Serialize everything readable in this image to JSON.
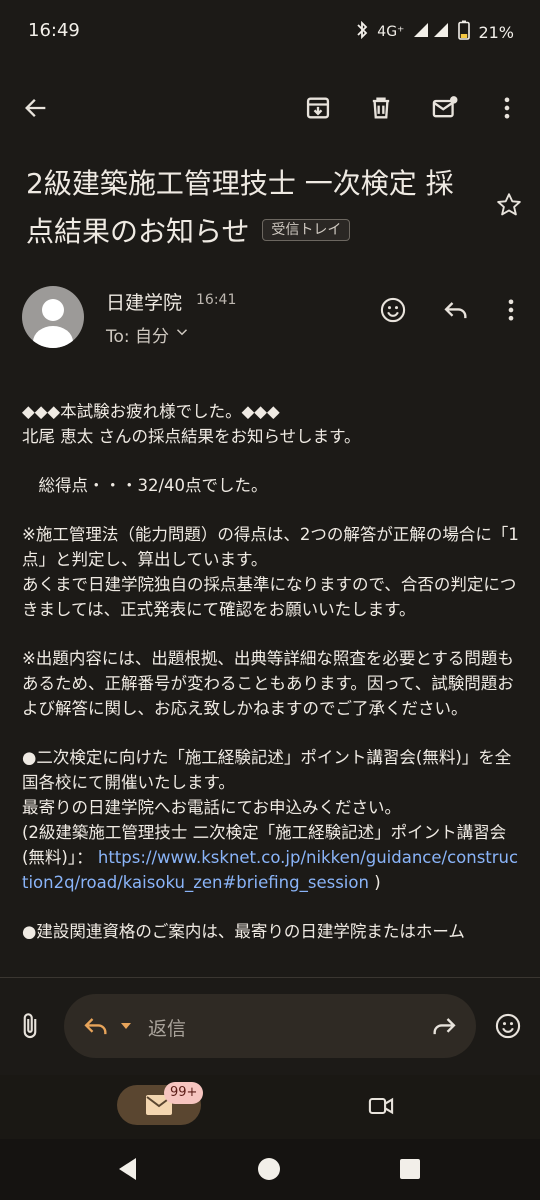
{
  "status_bar": {
    "time": "16:49",
    "network": "4G⁺",
    "battery": "21%"
  },
  "toolbar": {
    "icons": [
      "back-arrow-icon",
      "archive-icon",
      "delete-icon",
      "mark-unread-icon",
      "more-vert-icon"
    ]
  },
  "email": {
    "subject": "2級建築施工管理技士 一次検定 採点結果のお知らせ",
    "label_chip": "受信トレイ",
    "sender": "日建学院",
    "time": "16:41",
    "to": "To: 自分",
    "body": {
      "line1": "◆◆◆本試験お疲れ様でした。◆◆◆",
      "line2": "北尾 恵太 さんの採点結果をお知らせします。",
      "score": "　総得点・・・32/40点でした。",
      "note1": "※施工管理法（能力問題）の得点は、2つの解答が正解の場合に「1点」と判定し、算出しています。",
      "note2": "あくまで日建学院独自の採点基準になりますので、合否の判定につきましては、正式発表にて確認をお願いいたします。",
      "note3": "※出題内容には、出題根拠、出典等詳細な照査を必要とする問題もあるため、正解番号が変わることもあります。因って、試験問題および解答に関し、お応え致しかねますのでご了承ください。",
      "seminar1": "●二次検定に向けた「施工経験記述」ポイント講習会(無料)」を全国各校にて開催いたします。",
      "seminar2": "最寄りの日建学院へお電話にてお申込みください。",
      "seminar3": "(2級建築施工管理技士 二次検定「施工経験記述」ポイント講習会(無料)」：",
      "link": "https://www.ksknet.co.jp/nikken/guidance/construction2q/road/kaisoku_zen#briefing_session",
      "close_paren": " )",
      "cutoff": "●建設関連資格のご案内は、最寄りの日建学院またはホーム"
    }
  },
  "reply_bar": {
    "placeholder": "返信"
  },
  "bottom_nav": {
    "mail_badge": "99+"
  },
  "colors": {
    "background": "#1c1a17",
    "link": "#8ab4f8",
    "badge": "#f6c5c0",
    "mail_pill": "#5a4630"
  }
}
